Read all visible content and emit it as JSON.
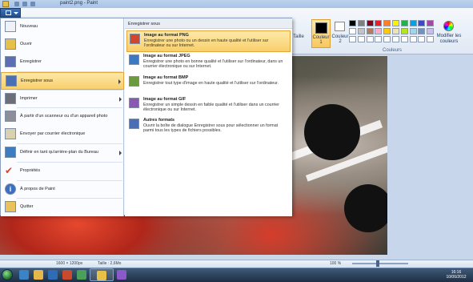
{
  "window": {
    "title": "paint2.png - Paint"
  },
  "ribbon": {
    "size_label": "Taille",
    "color1_label": "Couleur",
    "color1_number": "1",
    "color2_label": "Couleur",
    "color2_number": "2",
    "edit_colors_label": "Modifier les couleurs",
    "colors_group_label": "Couleurs",
    "palette": [
      "#000000",
      "#7f7f7f",
      "#880015",
      "#ed1c24",
      "#ff7f27",
      "#fff200",
      "#22b14c",
      "#00a2e8",
      "#3f48cc",
      "#a349a4",
      "#ffffff",
      "#c3c3c3",
      "#b97a57",
      "#ffaec9",
      "#ffc90e",
      "#efe4b0",
      "#b5e61d",
      "#99d9ea",
      "#7092be",
      "#c8bfe7",
      "#ffffff",
      "#ffffff",
      "#ffffff",
      "#ffffff",
      "#ffffff",
      "#ffffff",
      "#ffffff",
      "#ffffff",
      "#ffffff",
      "#ffffff"
    ],
    "color1_value": "#000000",
    "color2_value": "#ffffff"
  },
  "app_menu": {
    "items": [
      {
        "label": "Nouveau",
        "icon": "new-document-icon"
      },
      {
        "label": "Ouvrir",
        "icon": "open-folder-icon"
      },
      {
        "label": "Enregistrer",
        "icon": "save-disk-icon"
      },
      {
        "label": "Enregistrer sous",
        "icon": "save-as-icon",
        "selected": true
      },
      {
        "label": "Imprimer",
        "icon": "printer-icon"
      },
      {
        "label": "À partir d'un scanneur ou d'un appareil photo",
        "icon": "scanner-icon"
      },
      {
        "label": "Envoyer par courrier électronique",
        "icon": "email-icon"
      },
      {
        "label": "Définir en tant qu'arrière-plan du Bureau",
        "icon": "desktop-background-icon"
      },
      {
        "label": "Propriétés",
        "icon": "checkmark-icon"
      },
      {
        "label": "À propos de Paint",
        "icon": "info-icon"
      },
      {
        "label": "Quitter",
        "icon": "exit-icon"
      }
    ],
    "submenu": {
      "header": "Enregistrer sous",
      "items": [
        {
          "title": "Image au format PNG",
          "desc": "Enregistrer une photo ou un dessin en haute qualité et l'utiliser sur l'ordinateur ou sur Internet.",
          "icon": "png-image-icon",
          "selected": true
        },
        {
          "title": "Image au format JPEG",
          "desc": "Enregistrer une photo en bonne qualité et l'utiliser sur l'ordinateur, dans un courrier électronique ou sur Internet.",
          "icon": "jpeg-image-icon"
        },
        {
          "title": "Image au format BMP",
          "desc": "Enregistrer tout type d'image en haute qualité et l'utiliser sur l'ordinateur.",
          "icon": "bmp-image-icon"
        },
        {
          "title": "Image au format GIF",
          "desc": "Enregistrer un simple dessin en faible qualité et l'utiliser dans un courrier électronique ou sur Internet.",
          "icon": "gif-image-icon"
        },
        {
          "title": "Autres formats",
          "desc": "Ouvrir la boîte de dialogue Enregistrer sous pour sélectionner un format parmi tous les types de fichiers possibles.",
          "icon": "other-formats-icon"
        }
      ]
    }
  },
  "statusbar": {
    "dimensions": "1600 × 1200px",
    "size": "Taille : 2,6Mo",
    "zoom": "100 %"
  },
  "taskbar": {
    "time": "16:16",
    "date": "10/06/2012"
  }
}
